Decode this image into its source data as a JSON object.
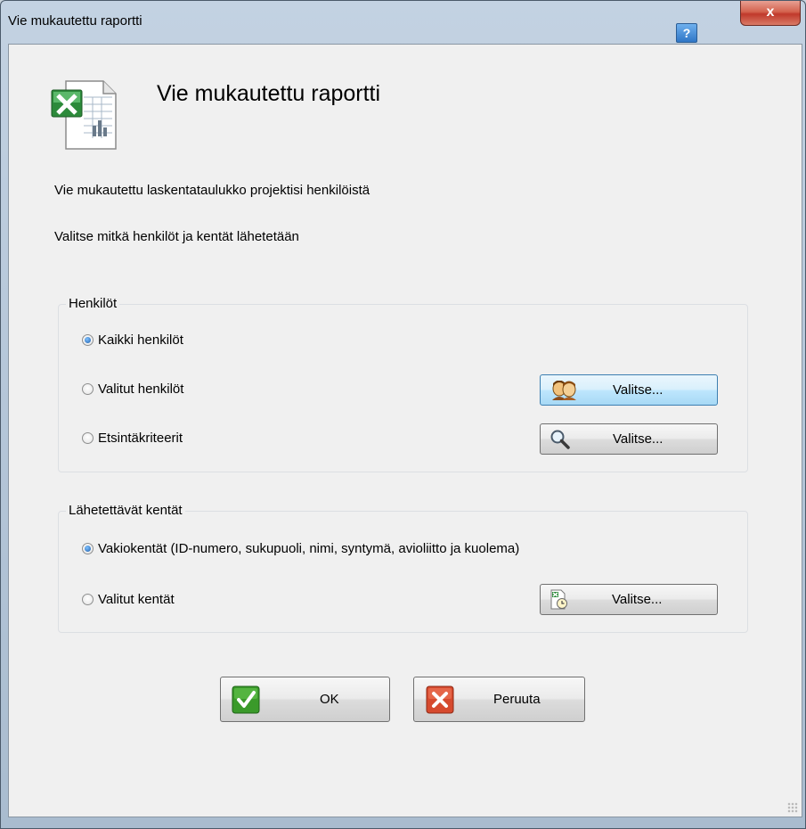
{
  "window": {
    "title": "Vie mukautettu raportti",
    "help_label": "?",
    "close_label": "x"
  },
  "header": {
    "title": "Vie mukautettu raportti",
    "icon": "excel-document-icon"
  },
  "description": {
    "line1": "Vie  mukautettu laskentataulukko projektisi henkilöistä",
    "line2": "Valitse mitkä henkilöt ja kentät lähetetään"
  },
  "people_group": {
    "legend": "Henkilöt",
    "options": [
      {
        "label": "Kaikki henkilöt",
        "checked": true
      },
      {
        "label": "Valitut henkilöt",
        "checked": false
      },
      {
        "label": "Etsintäkriteerit",
        "checked": false
      }
    ],
    "select_label": "Valitse..."
  },
  "fields_group": {
    "legend": "Lähetettävät kentät",
    "options": [
      {
        "label": "Vakiokentät (ID-numero, sukupuoli, nimi, syntymä, avioliitto ja kuolema)",
        "checked": true
      },
      {
        "label": "Valitut kentät",
        "checked": false
      }
    ],
    "select_label": "Valitse..."
  },
  "footer": {
    "ok_label": "OK",
    "cancel_label": "Peruuta"
  },
  "colors": {
    "ok_green": "#3a9a2a",
    "cancel_red": "#d64a2e",
    "accent_blue": "#2f76c6"
  }
}
